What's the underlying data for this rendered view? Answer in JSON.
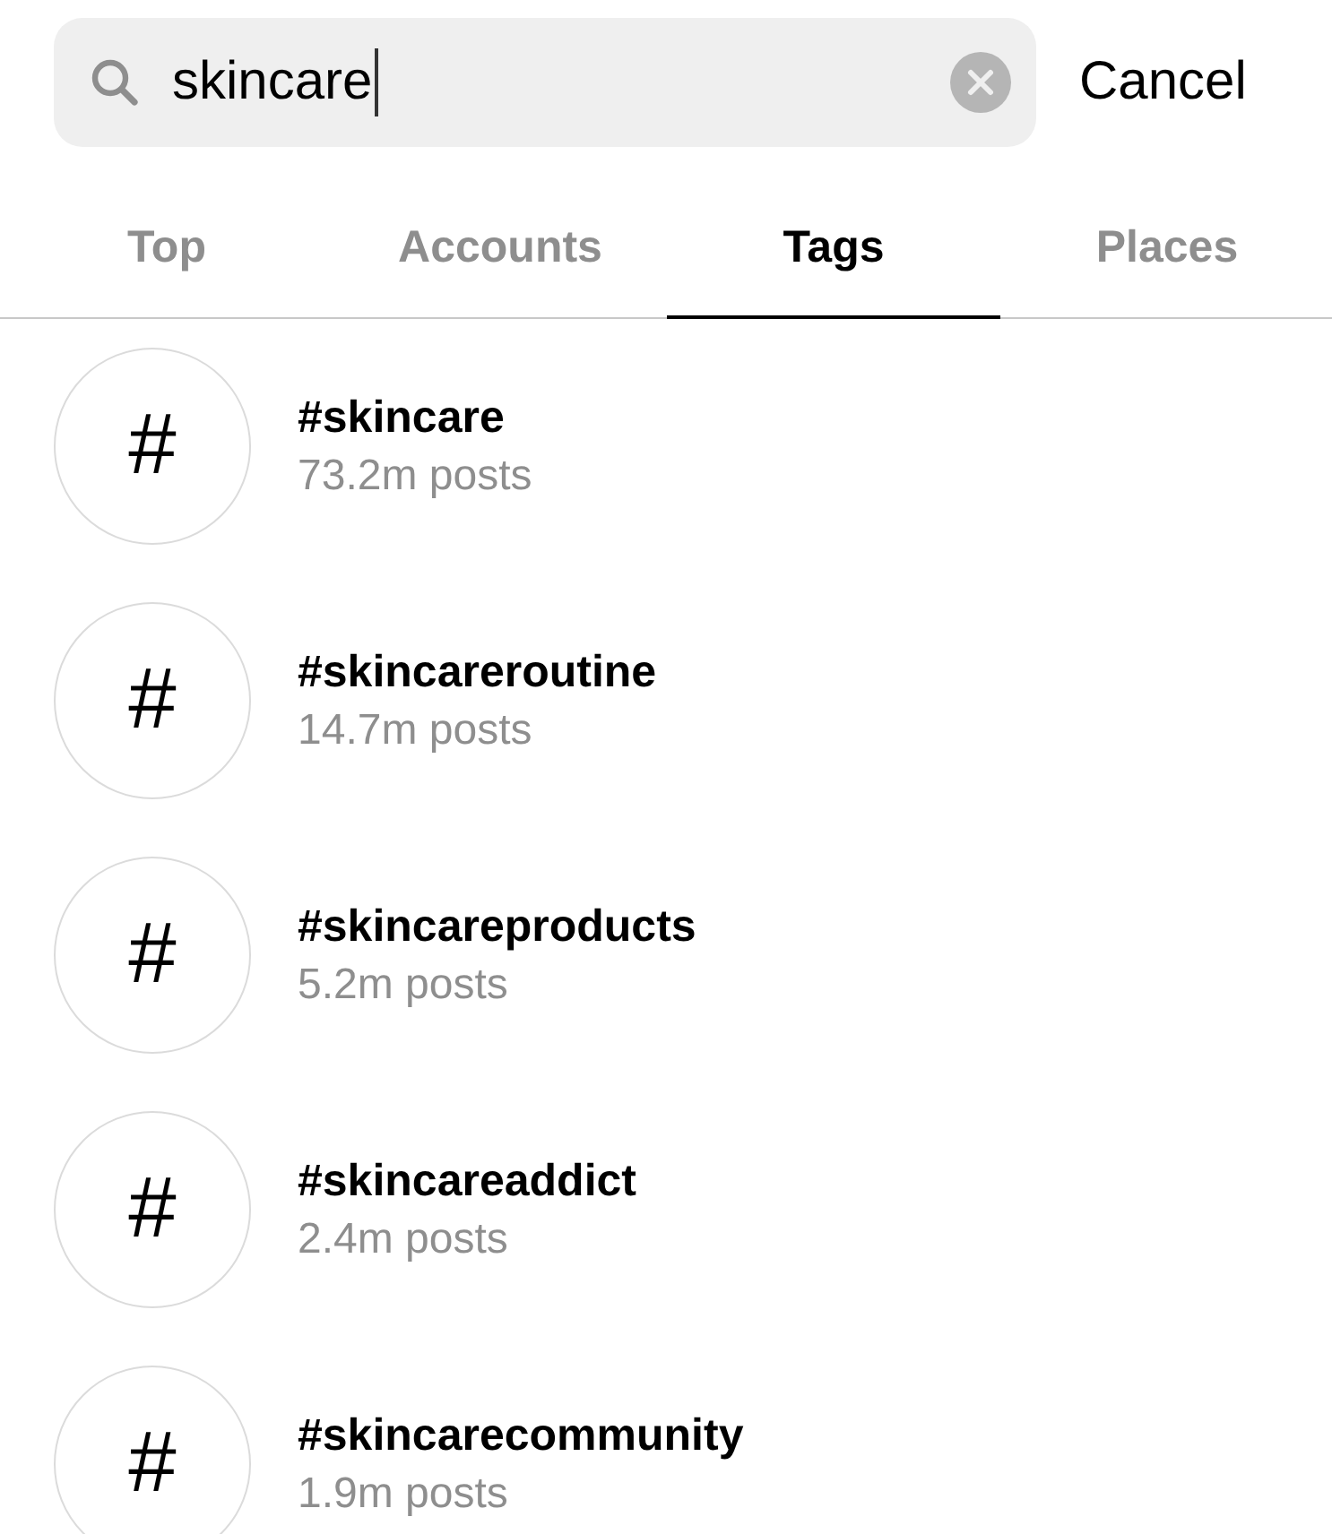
{
  "search": {
    "value": "skincare",
    "cancel": "Cancel"
  },
  "tabs": [
    {
      "label": "Top",
      "selected": false
    },
    {
      "label": "Accounts",
      "selected": false
    },
    {
      "label": "Tags",
      "selected": true
    },
    {
      "label": "Places",
      "selected": false
    }
  ],
  "results": [
    {
      "icon": "#",
      "tag": "#skincare",
      "posts": "73.2m posts"
    },
    {
      "icon": "#",
      "tag": "#skincareroutine",
      "posts": "14.7m posts"
    },
    {
      "icon": "#",
      "tag": "#skincareproducts",
      "posts": "5.2m posts"
    },
    {
      "icon": "#",
      "tag": "#skincareaddict",
      "posts": "2.4m posts"
    },
    {
      "icon": "#",
      "tag": "#skincarecommunity",
      "posts": "1.9m posts"
    }
  ]
}
